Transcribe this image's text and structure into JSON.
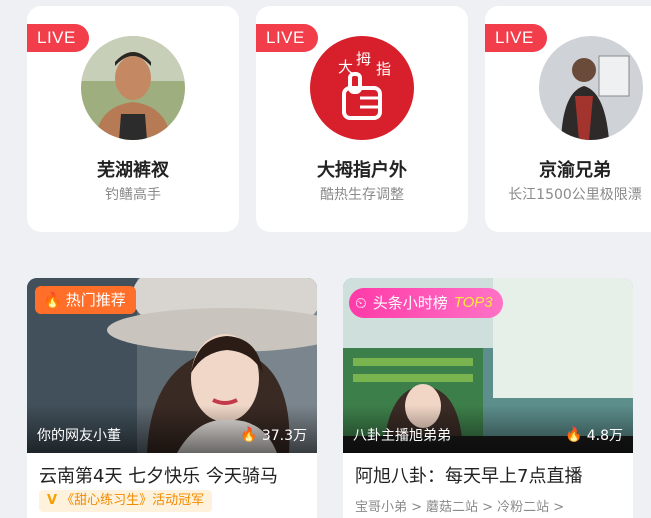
{
  "live_badge": "LIVE",
  "streamers": [
    {
      "name": "芜湖裤衩",
      "desc": "钓鳝高手"
    },
    {
      "name": "大拇指户外",
      "desc": "酷热生存调整"
    },
    {
      "name": "京渝兄弟",
      "desc": "长江1500公里极限漂"
    }
  ],
  "thumb_art": {
    "big_chars": [
      "大",
      "拇",
      "指"
    ]
  },
  "videos": [
    {
      "badge": "热门推荐",
      "streamer": "你的网友小董",
      "viewers": "37.3万",
      "title": "云南第4天 七夕快乐 今天骑马",
      "tag": "《甜心练习生》活动冠军"
    },
    {
      "badge": "头条小时榜",
      "badge_rank": "TOP3",
      "streamer": "八卦主播旭弟弟",
      "viewers": "4.8万",
      "title": "阿旭八卦：每天早上7点直播",
      "crumbs": [
        "宝哥小弟 >",
        "蘑菇二站 >",
        "冷粉二站 >"
      ]
    }
  ],
  "colors": {
    "live": "#f23d4b",
    "hot": "#ff6f2a",
    "tag_text": "#f28a00"
  }
}
